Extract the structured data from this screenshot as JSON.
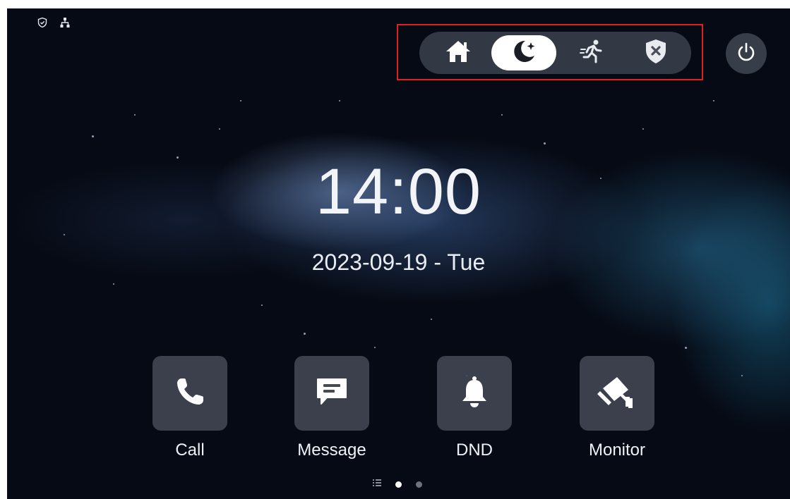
{
  "status_bar": {
    "icons": [
      "shield-check-icon",
      "network-icon"
    ]
  },
  "arming_modes": {
    "items": [
      {
        "name": "home-mode",
        "icon": "house-icon",
        "active": false
      },
      {
        "name": "night-mode",
        "icon": "moon-star-icon",
        "active": true
      },
      {
        "name": "away-mode",
        "icon": "running-person-icon",
        "active": false
      },
      {
        "name": "disarm-mode",
        "icon": "shield-x-icon",
        "active": false
      }
    ],
    "highlight_color": "#e02020"
  },
  "power": {
    "icon": "power-icon"
  },
  "clock": {
    "time": "14:00",
    "date": "2023-09-19 - Tue"
  },
  "apps": [
    {
      "label": "Call",
      "icon": "phone-icon"
    },
    {
      "label": "Message",
      "icon": "chat-icon"
    },
    {
      "label": "DND",
      "icon": "bell-icon"
    },
    {
      "label": "Monitor",
      "icon": "cctv-camera-icon"
    }
  ],
  "pager": {
    "pages": 2,
    "current": 1,
    "icons": [
      "list-icon"
    ]
  }
}
